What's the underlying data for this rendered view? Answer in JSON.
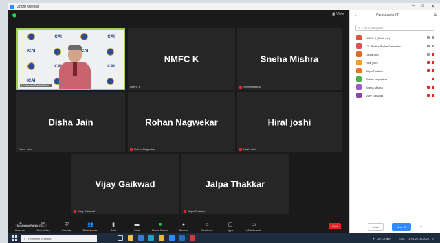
{
  "window": {
    "title": "Zoom Meeting"
  },
  "meeting": {
    "view_label": "View",
    "tiles": [
      {
        "name": "",
        "tag": "Moderator Partha Prat..",
        "video": true,
        "muted": false
      },
      {
        "name": "NMFC K",
        "tag": "NMFC K",
        "muted": false
      },
      {
        "name": "Sneha Mishra",
        "tag": "Sneha Mishra",
        "muted": true
      },
      {
        "name": "Disha Jain",
        "tag": "Disha Jain",
        "muted": false
      },
      {
        "name": "Rohan Nagwekar",
        "tag": "Rohan Nagwekar",
        "muted": true
      },
      {
        "name": "Hiral joshi",
        "tag": "Hiral joshi",
        "muted": true
      },
      {
        "name": "Vijay Gaikwad",
        "tag": "Vijay Gaikwad",
        "muted": true
      },
      {
        "name": "Jalpa Thakkar",
        "tag": "Jalpa Thakkar",
        "muted": true
      }
    ],
    "logo_text": "ICAI"
  },
  "toolbar": {
    "items": [
      {
        "label": "Unmute",
        "icon": "mic-icon"
      },
      {
        "label": "Stop Video",
        "icon": "video-icon"
      },
      {
        "label": "Security",
        "icon": "shield-icon"
      },
      {
        "label": "Participants",
        "icon": "people-icon"
      },
      {
        "label": "Polls",
        "icon": "poll-icon"
      },
      {
        "label": "Chat",
        "icon": "chat-icon"
      },
      {
        "label": "Share Screen",
        "icon": "share-icon"
      },
      {
        "label": "Record",
        "icon": "record-icon"
      },
      {
        "label": "Reactions",
        "icon": "reaction-icon"
      },
      {
        "label": "Apps",
        "icon": "apps-icon"
      },
      {
        "label": "Whiteboards",
        "icon": "whiteboard-icon"
      }
    ],
    "end_label": "End",
    "speaking_status": "Moderator Partha (D..."
  },
  "participants_panel": {
    "title": "Participants (9)",
    "search_placeholder": "Find a participant",
    "items": [
      {
        "name": "NMFC K (Host, me)",
        "color": "#e0533b"
      },
      {
        "name": "CA. Partha Pratim Debnatha",
        "color": "#d9534f"
      },
      {
        "name": "Disha Jain",
        "color": "#e06a2c"
      },
      {
        "name": "Hiral joshi",
        "color": "#f0a020"
      },
      {
        "name": "Jalpa Thakkar",
        "color": "#e07b25"
      },
      {
        "name": "Rohan Nagwekar",
        "color": "#4caf50"
      },
      {
        "name": "Sneha Mishra",
        "color": "#9c5ac9"
      },
      {
        "name": "Vijay Gaikwad",
        "color": "#8e44ad"
      }
    ],
    "invite_label": "Invite",
    "mute_all_label": "Mute All",
    "more_label": "..."
  },
  "taskbar": {
    "search_placeholder": "Type here to search",
    "weather": "28°C Haze",
    "lang": "ENG",
    "time": "10:01",
    "date": "27-08-2022"
  }
}
